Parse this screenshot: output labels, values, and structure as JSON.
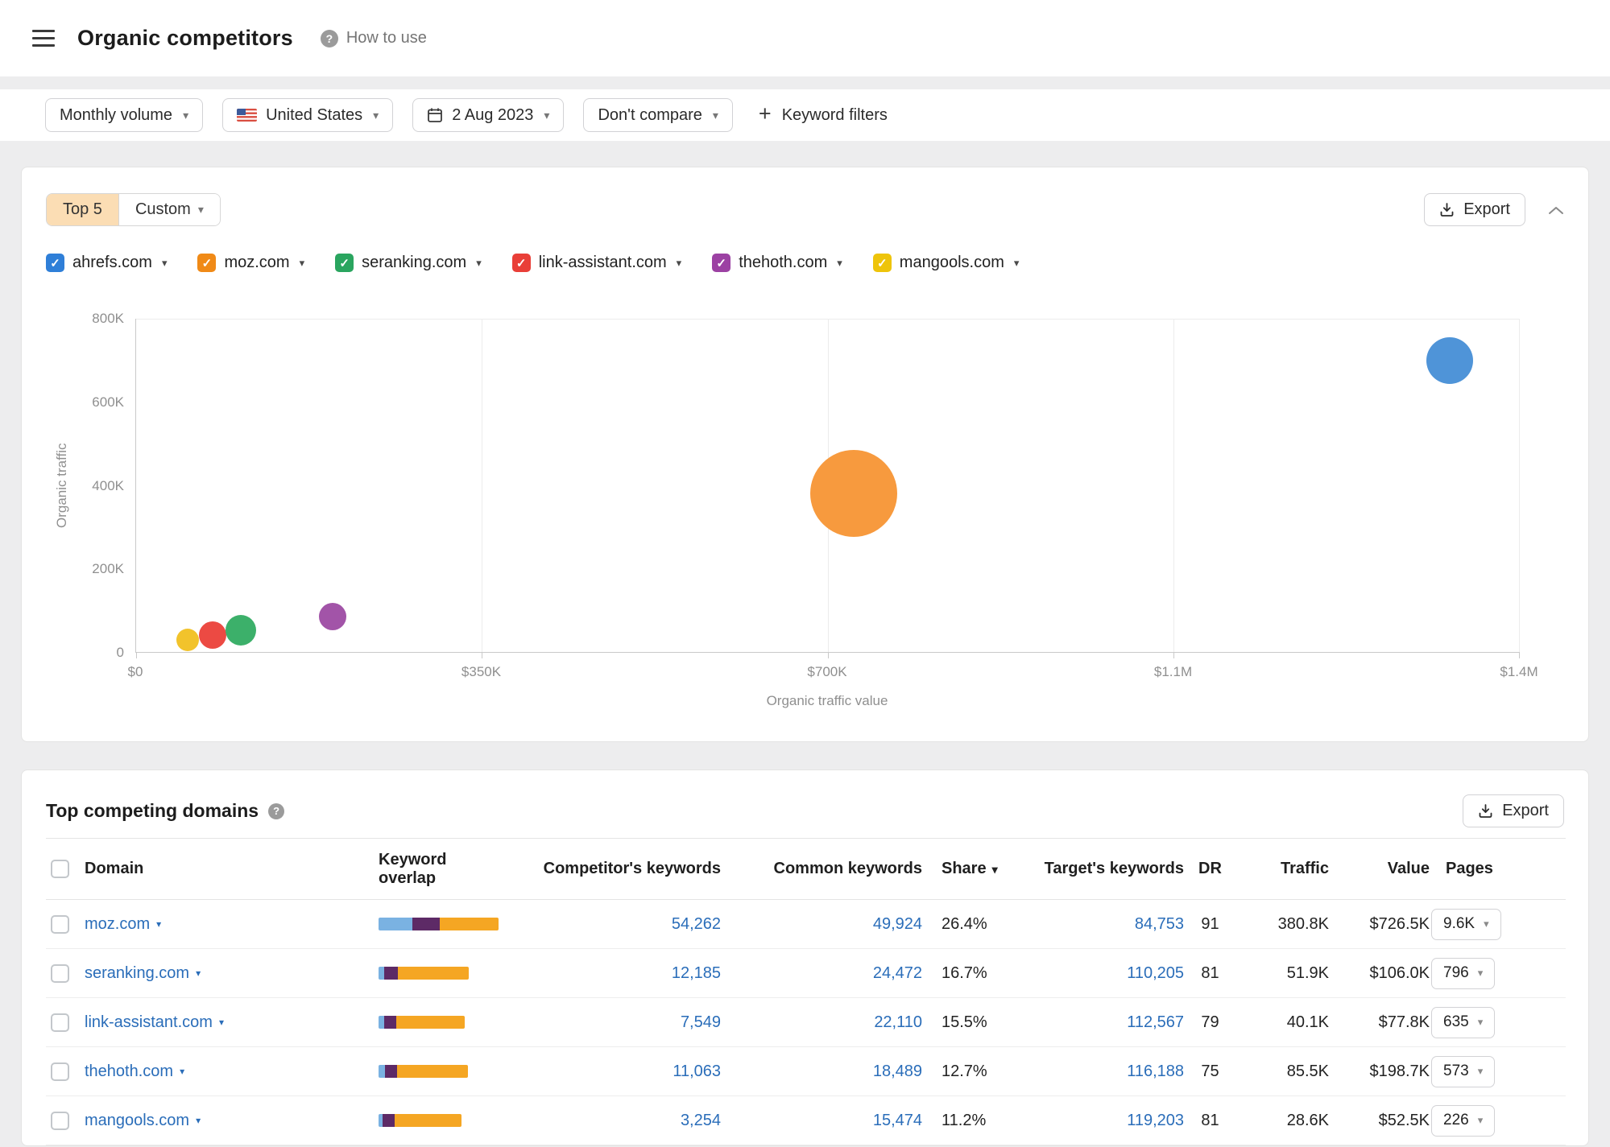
{
  "header": {
    "title": "Organic competitors",
    "help": "How to use"
  },
  "filters": {
    "volume": "Monthly volume",
    "country": "United States",
    "date": "2 Aug 2023",
    "compare": "Don't compare",
    "keyword_filters": "Keyword filters"
  },
  "chart_card": {
    "tab_top5": "Top 5",
    "tab_custom": "Custom",
    "export_label": "Export"
  },
  "legend": [
    {
      "label": "ahrefs.com",
      "color": "#2f7fd8"
    },
    {
      "label": "moz.com",
      "color": "#f08a17"
    },
    {
      "label": "seranking.com",
      "color": "#2aa55f"
    },
    {
      "label": "link-assistant.com",
      "color": "#e93f38"
    },
    {
      "label": "thehoth.com",
      "color": "#9c41a3"
    },
    {
      "label": "mangools.com",
      "color": "#eec40b"
    }
  ],
  "chart_data": {
    "type": "scatter",
    "title": "",
    "xlabel": "Organic traffic value",
    "ylabel": "Organic traffic",
    "xlim": [
      0,
      1400000
    ],
    "ylim": [
      0,
      800000
    ],
    "x_ticks": [
      "$0",
      "$350K",
      "$700K",
      "$1.1M",
      "$1.4M"
    ],
    "y_ticks": [
      "0",
      "200K",
      "400K",
      "600K",
      "800K"
    ],
    "grid": "vertical gridlines at each x tick, top horizontal line",
    "points": [
      {
        "name": "ahrefs.com",
        "x": 1330000,
        "y": 700000,
        "r": 29,
        "color": "#4f94d8"
      },
      {
        "name": "moz.com",
        "x": 726500,
        "y": 380800,
        "r": 54,
        "color": "#f79a3e"
      },
      {
        "name": "thehoth.com",
        "x": 198700,
        "y": 85500,
        "r": 17,
        "color": "#a254a8"
      },
      {
        "name": "mangools.com",
        "x": 52500,
        "y": 28600,
        "r": 14,
        "color": "#f2c32b"
      },
      {
        "name": "link-assistant.com",
        "x": 77800,
        "y": 40100,
        "r": 17,
        "color": "#ec4a43"
      },
      {
        "name": "seranking.com",
        "x": 106000,
        "y": 51900,
        "r": 19,
        "color": "#3cb06a"
      }
    ]
  },
  "table": {
    "title": "Top competing domains",
    "export_label": "Export",
    "columns": {
      "domain": "Domain",
      "overlap": "Keyword overlap",
      "competitors_keywords": "Competitor's keywords",
      "common_keywords": "Common keywords",
      "share": "Share",
      "targets_keywords": "Target's keywords",
      "dr": "DR",
      "traffic": "Traffic",
      "value": "Value",
      "pages": "Pages"
    },
    "overlap_colors": [
      "#7ab2e2",
      "#5d2a66",
      "#f5a623"
    ],
    "rows": [
      {
        "domain": "moz.com",
        "overlap": [
          42,
          34,
          73
        ],
        "competitors_keywords": "54,262",
        "common_keywords": "49,924",
        "share": "26.4%",
        "targets_keywords": "84,753",
        "dr": "91",
        "traffic": "380.8K",
        "value": "$726.5K",
        "pages": "9.6K"
      },
      {
        "domain": "seranking.com",
        "overlap": [
          7,
          17,
          88
        ],
        "competitors_keywords": "12,185",
        "common_keywords": "24,472",
        "share": "16.7%",
        "targets_keywords": "110,205",
        "dr": "81",
        "traffic": "51.9K",
        "value": "$106.0K",
        "pages": "796"
      },
      {
        "domain": "link-assistant.com",
        "overlap": [
          7,
          15,
          85
        ],
        "competitors_keywords": "7,549",
        "common_keywords": "22,110",
        "share": "15.5%",
        "targets_keywords": "112,567",
        "dr": "79",
        "traffic": "40.1K",
        "value": "$77.8K",
        "pages": "635"
      },
      {
        "domain": "thehoth.com",
        "overlap": [
          8,
          15,
          88
        ],
        "competitors_keywords": "11,063",
        "common_keywords": "18,489",
        "share": "12.7%",
        "targets_keywords": "116,188",
        "dr": "75",
        "traffic": "85.5K",
        "value": "$198.7K",
        "pages": "573"
      },
      {
        "domain": "mangools.com",
        "overlap": [
          5,
          15,
          83
        ],
        "competitors_keywords": "3,254",
        "common_keywords": "15,474",
        "share": "11.2%",
        "targets_keywords": "119,203",
        "dr": "81",
        "traffic": "28.6K",
        "value": "$52.5K",
        "pages": "226"
      }
    ]
  }
}
